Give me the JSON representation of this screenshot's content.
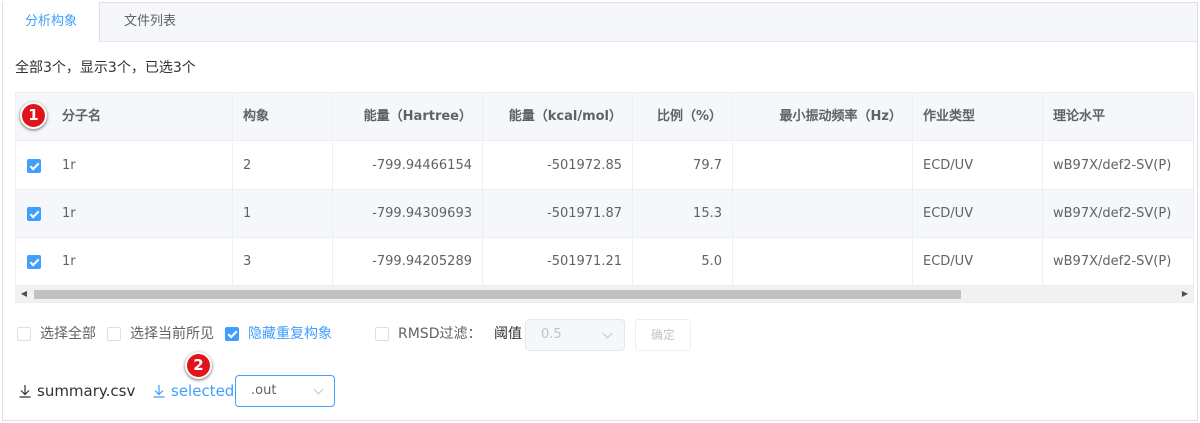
{
  "tabs": [
    {
      "label": "分析构象",
      "active": true
    },
    {
      "label": "文件列表",
      "active": false
    }
  ],
  "summary_text": "全部3个，显示3个，已选3个",
  "table": {
    "headers": {
      "name": "分子名",
      "conformer": "构象",
      "energy_hartree": "能量（Hartree）",
      "energy_kcal": "能量（kcal/mol）",
      "ratio": "比例（%）",
      "min_freq": "最小振动频率（Hz）",
      "job_type": "作业类型",
      "theory": "理论水平"
    },
    "rows": [
      {
        "checked": true,
        "name": "1r",
        "conformer": "2",
        "energy_hartree": "-799.94466154",
        "energy_kcal": "-501972.85",
        "ratio": "79.7",
        "min_freq": "",
        "job_type": "ECD/UV",
        "theory": "wB97X/def2-SV(P)"
      },
      {
        "checked": true,
        "name": "1r",
        "conformer": "1",
        "energy_hartree": "-799.94309693",
        "energy_kcal": "-501971.87",
        "ratio": "15.3",
        "min_freq": "",
        "job_type": "ECD/UV",
        "theory": "wB97X/def2-SV(P)"
      },
      {
        "checked": true,
        "name": "1r",
        "conformer": "3",
        "energy_hartree": "-799.94205289",
        "energy_kcal": "-501971.21",
        "ratio": "5.0",
        "min_freq": "",
        "job_type": "ECD/UV",
        "theory": "wB97X/def2-SV(P)"
      }
    ]
  },
  "filters": {
    "select_all": {
      "label": "选择全部",
      "checked": false
    },
    "select_visible": {
      "label": "选择当前所见",
      "checked": false
    },
    "hide_duplicates": {
      "label": "隐藏重复构象",
      "checked": true
    },
    "rmsd": {
      "label": "RMSD过滤：",
      "checked": false
    },
    "threshold_label": "阈值",
    "threshold_value": "0.5",
    "confirm_label": "确定"
  },
  "downloads": {
    "summary_label": "summary.csv",
    "selected_label": "selected",
    "format_value": ".out"
  },
  "annotations": [
    "1",
    "2"
  ],
  "colors": {
    "accent": "#409eff",
    "badge": "#e0141a",
    "header_bg": "#f5f7fa",
    "border": "#ebeef5"
  }
}
